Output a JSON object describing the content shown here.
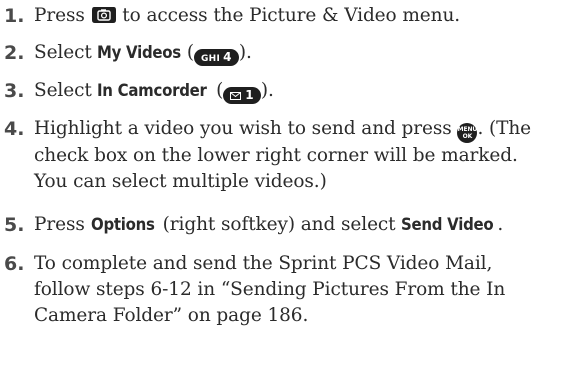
{
  "steps": [
    {
      "num": "1.",
      "t1": "Press",
      "t2": "to access the Picture & Video menu.",
      "icon": "camera-key-icon"
    },
    {
      "num": "2.",
      "t1": "Select",
      "bold": "My Videos",
      "t2": "(",
      "key_label": "GHI",
      "key_digit": "4",
      "t3": ")."
    },
    {
      "num": "3.",
      "t1": "Select",
      "bold": "In Camcorder",
      "t2": "(",
      "key_digit": "1",
      "t3": ").",
      "icon": "envelope-icon"
    },
    {
      "num": "4.",
      "line1a": "Highlight a video you wish to send and press",
      "menu_top": "MENU",
      "menu_bottom": "OK",
      "line1b": ". (The",
      "line2": "check box on the lower right corner will be marked.",
      "line3": "You can select multiple videos.)"
    },
    {
      "num": "5.",
      "t1": "Press",
      "bold": "Options",
      "t2": "(right softkey) and select",
      "bold2": "Send Video",
      "t3": "."
    },
    {
      "num": "6.",
      "line1": "To complete and send the Sprint PCS Video Mail,",
      "line2": "follow steps 6-12 in “Sending Pictures From the In",
      "line3": "Camera Folder” on page 186."
    }
  ]
}
